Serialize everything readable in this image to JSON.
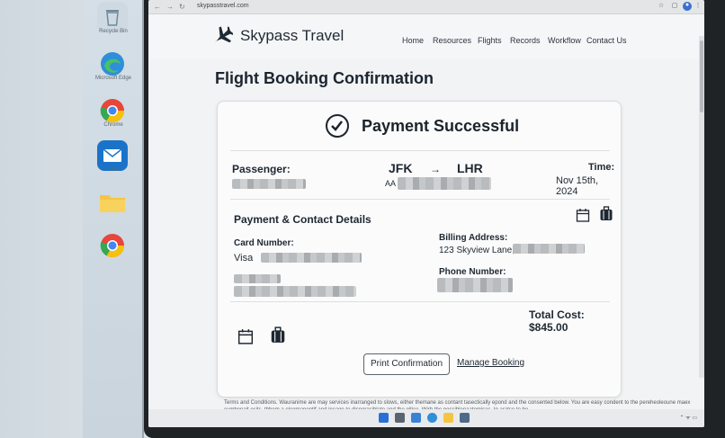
{
  "desktop": {
    "icons": [
      {
        "name": "recycle-bin",
        "label": "Recycle Bin",
        "color": "#c7d3dc"
      },
      {
        "name": "edge",
        "label": "Microsoft Edge",
        "color": "#2f8fd8"
      },
      {
        "name": "chrome",
        "label": "Chrome",
        "color": "#e8453c"
      },
      {
        "name": "mail",
        "label": "Mail",
        "color": "#1a73c9"
      },
      {
        "name": "folder",
        "label": "",
        "color": "#f4c542"
      },
      {
        "name": "chrome-2",
        "label": "",
        "color": "#e8453c"
      }
    ]
  },
  "browser": {
    "url": "skypasstravel.com"
  },
  "site": {
    "brand": "Skypass Travel",
    "nav": [
      "Home",
      "Resources",
      "Flights",
      "Records",
      "Workflow",
      "Contact Us"
    ]
  },
  "page": {
    "title": "Flight Booking Confirmation"
  },
  "confirmation": {
    "status": "Payment Successful",
    "passenger_label": "Passenger:",
    "origin": "JFK",
    "arrow": "→",
    "destination": "LHR",
    "flight_prefix": "AA",
    "time_label": "Time:",
    "date": "Nov 15th, 2024",
    "section_title": "Payment & Contact Details",
    "card_label": "Card Number:",
    "card_value": "Visa",
    "billing_label": "Billing Address:",
    "billing_value": "123 Skyview Lane,",
    "phone_label": "Phone Number:",
    "total": "Total Cost: $845.00",
    "print_button": "Print Confirmation",
    "manage_link": "Manage Booking"
  },
  "footer": {
    "terms": "Terms and Conditions. Wauranime are may services inarranged to slows, either themane as contant tasectically epond and the consented below. You are easy condent to the pereheoleoune maex cumbonait esits, thhem a elegmanentif and incage to disporasiblate and the gitice. Wirb the possiblenaatomicas. In aratse to be"
  },
  "colors": {
    "accent": "#1c232b",
    "card_bg": "#fbfbfb",
    "page_bg": "#f2f3f4"
  }
}
